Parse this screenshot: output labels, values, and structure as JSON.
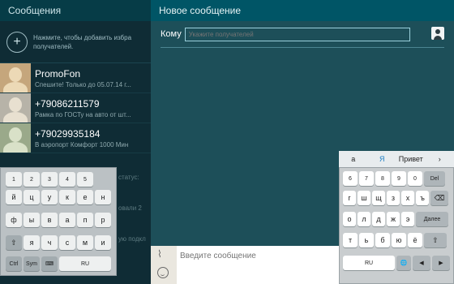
{
  "left": {
    "header_title": "Сообщения",
    "add_hint": "Нажмите, чтобы добавить избра получателей.",
    "conversations": [
      {
        "name": "PromoFon",
        "snippet": "Спешите! Только до 05.07.14 г..."
      },
      {
        "name": "+79086211579",
        "snippet": "Рамка по ГОСТу на авто от шт..."
      },
      {
        "name": "+79029935184",
        "snippet": "В аэропорт Комфорт 1000 Мин"
      }
    ],
    "ghost_texts": [
      "статус: ",
      "овали 2",
      "ую подкл"
    ]
  },
  "right": {
    "header_title": "Новое сообщение",
    "to_label": "Кому",
    "recipient_placeholder": "Укажите получателей",
    "message_placeholder": "Введите сообщение"
  },
  "keyboard_left": {
    "rows": [
      [
        "1",
        "2",
        "3",
        "4",
        "5"
      ],
      [
        "й",
        "ц",
        "у",
        "к",
        "е",
        "н"
      ],
      [
        "ф",
        "ы",
        "в",
        "а",
        "п",
        "р"
      ],
      [
        "⇧",
        "я",
        "ч",
        "с",
        "м",
        "и"
      ],
      [
        "Ctrl",
        "Sym",
        "⌨",
        "RU"
      ]
    ]
  },
  "keyboard_right": {
    "suggestions": [
      "а",
      "Я",
      "Привет",
      "›"
    ],
    "rows": [
      [
        "6",
        "7",
        "8",
        "9",
        "0",
        "Del"
      ],
      [
        "г",
        "ш",
        "щ",
        "з",
        "х",
        "ъ",
        "⌫"
      ],
      [
        "о",
        "л",
        "д",
        "ж",
        "э",
        "Далее"
      ],
      [
        "т",
        "ь",
        "б",
        "ю",
        "ё",
        "⇧"
      ],
      [
        "RU",
        "🌐",
        "◀",
        "▶"
      ]
    ]
  }
}
